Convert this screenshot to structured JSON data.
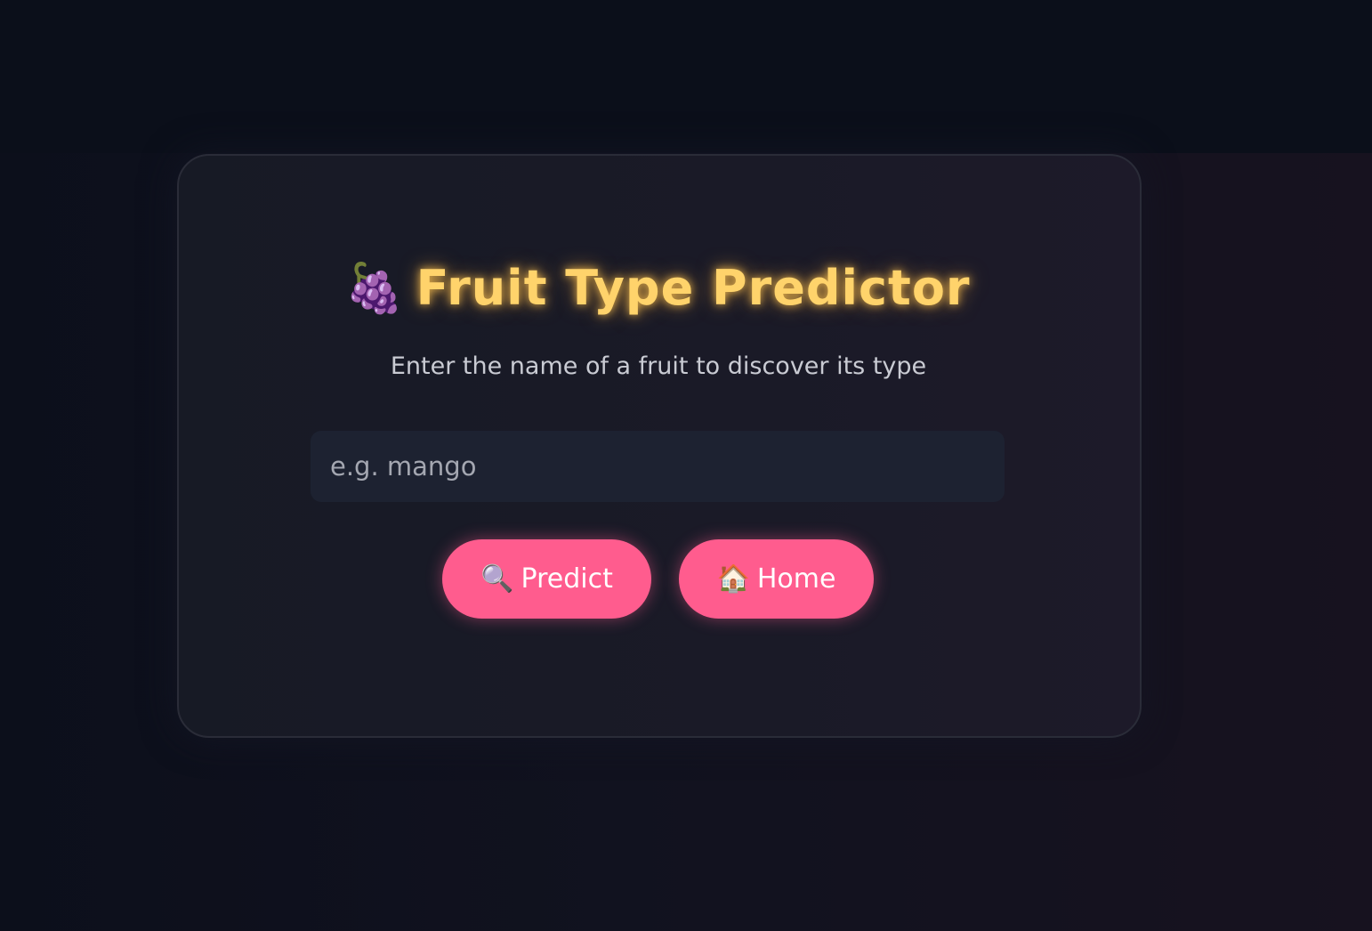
{
  "header": {
    "title_icon": "🍇",
    "title_icon_name": "grapes-icon",
    "title": "Fruit Type Predictor",
    "subtitle": "Enter the name of a fruit to discover its type"
  },
  "form": {
    "fruit_input": {
      "value": "",
      "placeholder": "e.g. mango"
    },
    "predict_button": {
      "icon": "🔍",
      "icon_name": "magnifying-glass-icon",
      "label": "Predict"
    },
    "home_button": {
      "icon": "🏠",
      "icon_name": "house-icon",
      "label": "Home"
    }
  },
  "colors": {
    "background": "#0b0f1a",
    "card": "#1a1a27",
    "title": "#ffd36b",
    "button": "#ff5c8e",
    "input_bg": "#1d2231"
  }
}
